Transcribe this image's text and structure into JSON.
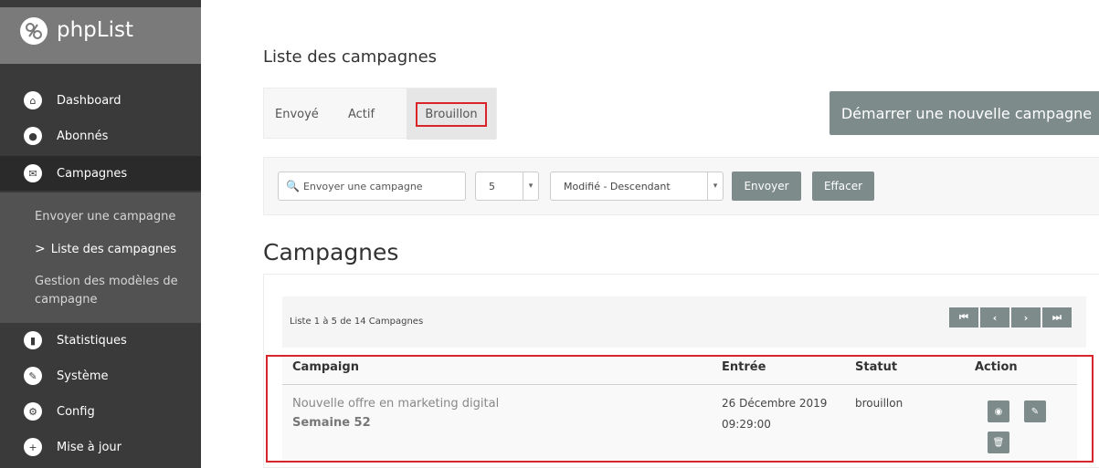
{
  "app": {
    "logo_text": "phpList"
  },
  "sidebar": {
    "items": [
      {
        "label": "Dashboard",
        "icon": "home-icon"
      },
      {
        "label": "Abonnés",
        "icon": "user-icon"
      },
      {
        "label": "Campagnes",
        "icon": "envelope-icon"
      },
      {
        "label": "Statistiques",
        "icon": "chart-icon"
      },
      {
        "label": "Système",
        "icon": "wrench-icon"
      },
      {
        "label": "Config",
        "icon": "gear-icon"
      },
      {
        "label": "Mise à jour",
        "icon": "plus-icon"
      }
    ],
    "submenu": {
      "items": [
        {
          "label": "Envoyer une campagne"
        },
        {
          "label": "Liste des campagnes",
          "marker": ">"
        },
        {
          "label_line1": "Gestion des modèles de",
          "label_line2": "campagne"
        }
      ]
    }
  },
  "page": {
    "title": "Liste des campagnes",
    "tabs": [
      {
        "label": "Envoyé"
      },
      {
        "label": "Actif"
      },
      {
        "label": "Brouillon",
        "active": true
      }
    ],
    "new_campaign_button": "Démarrer une nouvelle campagne",
    "filter": {
      "search_placeholder": "Envoyer une campagne",
      "per_page": "5",
      "sort": "Modifié - Descendant",
      "submit_label": "Envoyer",
      "clear_label": "Effacer"
    },
    "section_title": "Campagnes",
    "listing": {
      "summary": "Liste 1 à 5 de 14 Campagnes"
    },
    "pager": {
      "first": "⏮",
      "prev": "‹",
      "next": "›",
      "last": "⏭"
    },
    "table": {
      "headers": {
        "campaign": "Campaign",
        "entry": "Entrée",
        "status": "Statut",
        "action": "Action"
      },
      "rows": [
        {
          "title": "Nouvelle offre en marketing digital",
          "subtitle": "Semaine 52",
          "date": "26 Décembre 2019",
          "time": "09:29:00",
          "status": "brouillon"
        }
      ]
    }
  },
  "colors": {
    "sidebar_bg": "#3a3a3a",
    "button_gray": "#7d8b8b",
    "highlight_red": "#d9252a"
  }
}
